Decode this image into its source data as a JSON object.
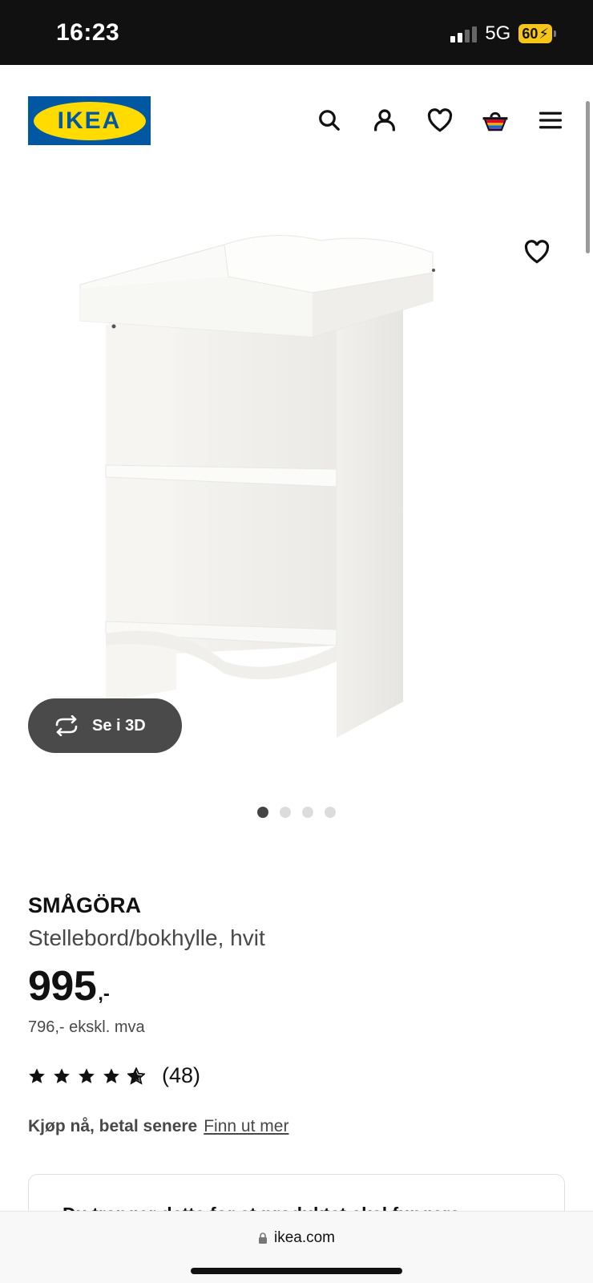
{
  "status": {
    "time": "16:23",
    "network": "5G",
    "battery": "60"
  },
  "header": {
    "logo_text": "IKEA",
    "icons": [
      "search-icon",
      "account-icon",
      "heart-icon",
      "basket-icon",
      "menu-icon"
    ]
  },
  "gallery": {
    "see_3d_label": "Se i 3D",
    "dots": 4,
    "active_dot": 1
  },
  "product": {
    "name": "SMÅGÖRA",
    "description": "Stellebord/bokhylle, hvit",
    "price": "995",
    "price_suffix": ",-",
    "price_ex_vat": "796,- ekskl. mva",
    "rating_value": 4.5,
    "rating_count": "(48)"
  },
  "financing": {
    "bold": "Kjøp nå, betal senere",
    "link": "Finn ut mer"
  },
  "required_box": {
    "title": "Du trenger dette for at produktet skal fungere:"
  },
  "browser": {
    "url": "ikea.com"
  },
  "colors": {
    "ikea_blue": "#0058a3",
    "ikea_yellow": "#ffdb00"
  }
}
